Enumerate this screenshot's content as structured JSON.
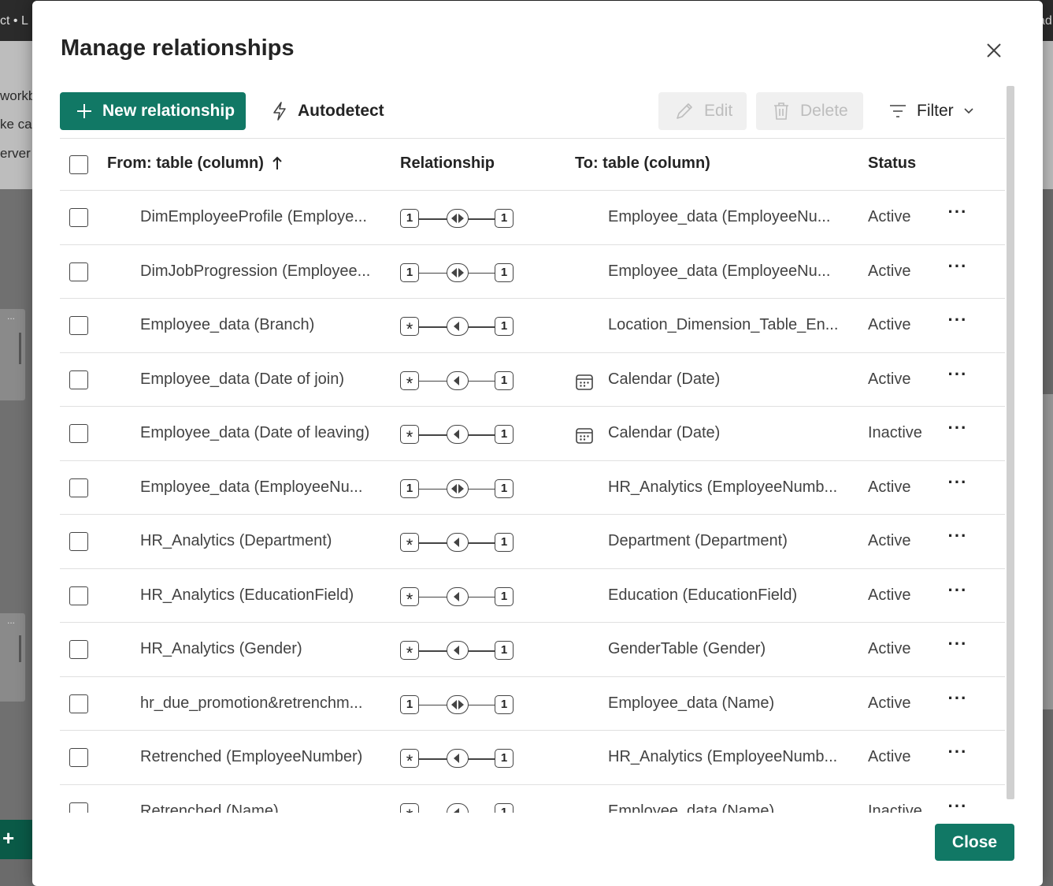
{
  "background": {
    "top_left_text": "ct • L",
    "top_right_text": "ad",
    "left_lines": [
      "workb",
      "ke ca",
      "erver"
    ],
    "card_dots": "...",
    "plus": "+"
  },
  "dialog": {
    "title": "Manage relationships",
    "toolbar": {
      "new_relationship": "New relationship",
      "autodetect": "Autodetect",
      "edit": "Edit",
      "delete": "Delete",
      "filter": "Filter"
    },
    "columns": {
      "from": "From: table (column)",
      "relationship": "Relationship",
      "to": "To: table (column)",
      "status": "Status"
    },
    "rows": [
      {
        "from": "DimEmployeeProfile (Employe...",
        "from_card": "1",
        "to_card": "1",
        "direction": "both",
        "to": "Employee_data (EmployeeNu...",
        "to_icon": "",
        "status": "Active"
      },
      {
        "from": "DimJobProgression (Employee...",
        "from_card": "1",
        "to_card": "1",
        "direction": "both",
        "to": "Employee_data (EmployeeNu...",
        "to_icon": "",
        "status": "Active"
      },
      {
        "from": "Employee_data (Branch)",
        "from_card": "*",
        "to_card": "1",
        "direction": "single",
        "to": "Location_Dimension_Table_En...",
        "to_icon": "",
        "status": "Active"
      },
      {
        "from": "Employee_data (Date of join)",
        "from_card": "*",
        "to_card": "1",
        "direction": "single",
        "to": "Calendar (Date)",
        "to_icon": "calendar-icon",
        "status": "Active"
      },
      {
        "from": "Employee_data (Date of leaving)",
        "from_card": "*",
        "to_card": "1",
        "direction": "single",
        "to": "Calendar (Date)",
        "to_icon": "calendar-icon",
        "status": "Inactive"
      },
      {
        "from": "Employee_data (EmployeeNu...",
        "from_card": "1",
        "to_card": "1",
        "direction": "both",
        "to": "HR_Analytics (EmployeeNumb...",
        "to_icon": "",
        "status": "Active"
      },
      {
        "from": "HR_Analytics (Department)",
        "from_card": "*",
        "to_card": "1",
        "direction": "single",
        "to": "Department (Department)",
        "to_icon": "",
        "status": "Active"
      },
      {
        "from": "HR_Analytics (EducationField)",
        "from_card": "*",
        "to_card": "1",
        "direction": "single",
        "to": "Education (EducationField)",
        "to_icon": "",
        "status": "Active"
      },
      {
        "from": "HR_Analytics (Gender)",
        "from_card": "*",
        "to_card": "1",
        "direction": "single",
        "to": "GenderTable (Gender)",
        "to_icon": "",
        "status": "Active"
      },
      {
        "from": "hr_due_promotion&retrenchm...",
        "from_card": "1",
        "to_card": "1",
        "direction": "both",
        "to": "Employee_data (Name)",
        "to_icon": "",
        "status": "Active"
      },
      {
        "from": "Retrenched (EmployeeNumber)",
        "from_card": "*",
        "to_card": "1",
        "direction": "single",
        "to": "HR_Analytics (EmployeeNumb...",
        "to_icon": "",
        "status": "Active"
      },
      {
        "from": "Retrenched (Name)",
        "from_card": "*",
        "to_card": "1",
        "direction": "single",
        "to": "Employee_data (Name)",
        "to_icon": "",
        "status": "Inactive"
      }
    ],
    "more_label": "···",
    "close_button": "Close"
  },
  "colors": {
    "accent": "#117865",
    "disabled_bg": "#f0f0f0",
    "disabled_text": "#bdbdbd"
  }
}
